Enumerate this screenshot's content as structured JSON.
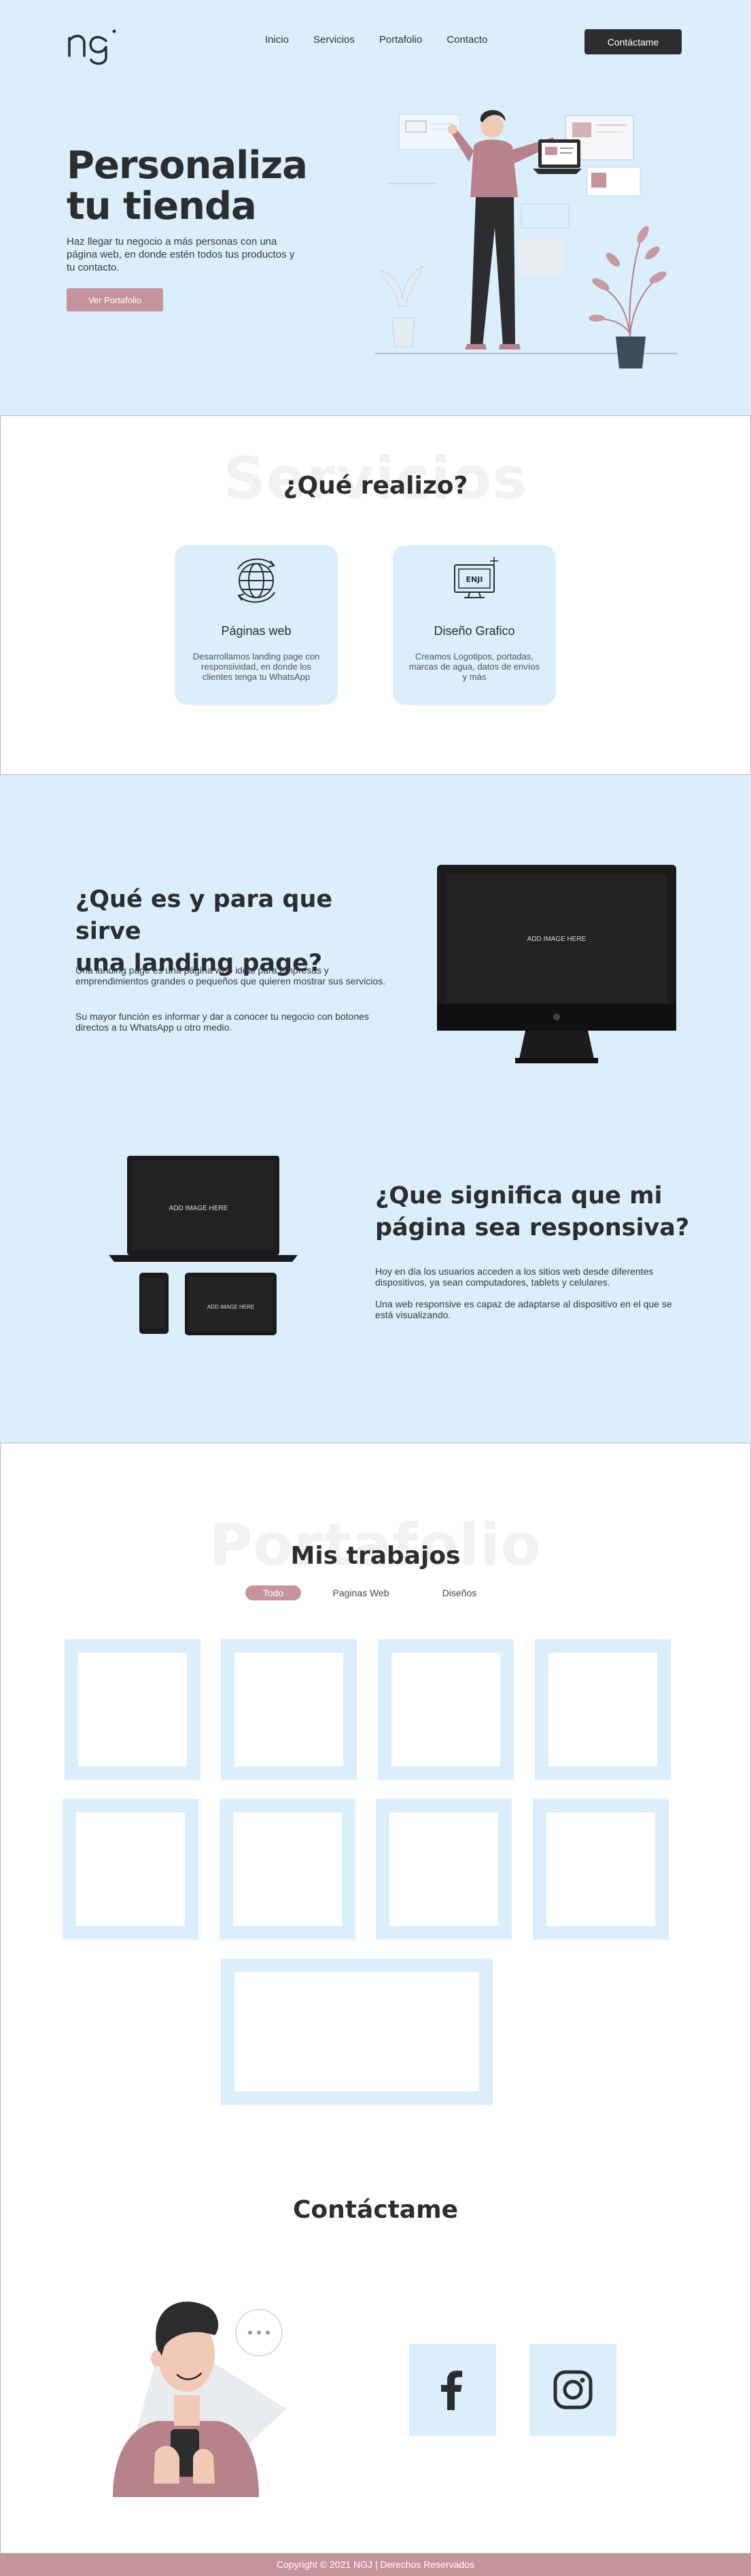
{
  "brand": {
    "logo_text": "ng"
  },
  "nav": {
    "items": [
      "Inicio",
      "Servicios",
      "Portafolio",
      "Contacto"
    ],
    "cta": "Contáctame"
  },
  "hero": {
    "title_line1": "Personaliza",
    "title_line2": "tu tienda",
    "description": "Haz llegar tu negocio a más personas con una página web, en donde estén todos tus productos y tu contacto.",
    "button": "Ver Portafolio"
  },
  "services": {
    "watermark": "Servicios",
    "title": "¿Qué realizo?",
    "cards": [
      {
        "icon": "globe-icon",
        "title": "Páginas web",
        "description": "Desarrollamos landing page con responsividad, en donde los clientes tenga tu WhatsApp"
      },
      {
        "icon": "graphic-design-icon",
        "title": "Diseño Grafico",
        "description": "Creamos Logotipos, portadas, marcas de agua, datos de envíos y más"
      }
    ]
  },
  "landing": {
    "title_line1": "¿Qué es  y para que sirve",
    "title_line2": "una landing page?",
    "paragraph1": "Una landing page es una página web ideal para empresas y emprendimientos grandes o pequeños que quieren mostrar sus servicios.",
    "paragraph2": "Su mayor función es informar y dar a conocer tu negocio con botones directos a tu WhatsApp u otro medio.",
    "mock_label": "ADD IMAGE HERE"
  },
  "responsive": {
    "title_line1": "¿Que significa que mi",
    "title_line2": "página sea responsiva?",
    "paragraph1": "Hoy en día los usuarios acceden a los sitios web desde diferentes dispositivos, ya sean computadores, tablets y celulares.",
    "paragraph2": "Una web responsive es capaz de adaptarse al dispositivo en el que se está visualizando.",
    "mock_label": "ADD IMAGE HERE"
  },
  "portfolio": {
    "watermark": "Portafolio",
    "title": "Mis trabajos",
    "filters": [
      "Todo",
      "Paginas Web",
      "Diseños"
    ],
    "active_filter": "Todo"
  },
  "contact": {
    "title": "Contáctame",
    "social": [
      "facebook-icon",
      "instagram-icon"
    ]
  },
  "footer": {
    "text": "Copyright © 2021 NGJ | Derechos Reservados"
  },
  "colors": {
    "light_blue": "#daeefc",
    "dark": "#2b2d2e",
    "rose": "#c4939b",
    "white": "#ffffff"
  }
}
